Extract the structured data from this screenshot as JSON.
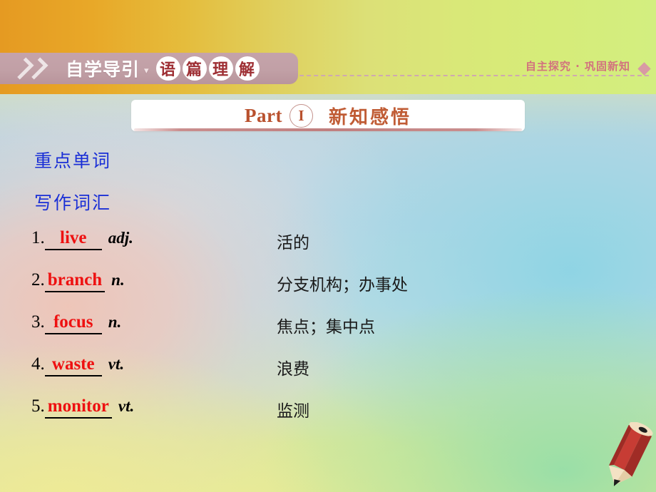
{
  "header": {
    "left_title": "自学导引",
    "separator": "▾",
    "circled_chars": [
      "语",
      "篇",
      "理",
      "解"
    ],
    "right_text": "自主探究 · 巩固新知",
    "chevron_icon": "double-chevron-right-icon",
    "diamond_icon": "diamond-icon"
  },
  "part": {
    "word": "Part",
    "numeral": "I",
    "title_cn": "新知感悟"
  },
  "sections": {
    "heading_1": "重点单词",
    "heading_2": "写作词汇"
  },
  "vocabulary": [
    {
      "index": "1.",
      "answer": "live",
      "pos": "adj.",
      "meaning": "活的"
    },
    {
      "index": "2.",
      "answer": "branch",
      "pos": "n.",
      "meaning": "分支机构；办事处"
    },
    {
      "index": "3.",
      "answer": "focus",
      "pos": "n.",
      "meaning": "焦点；集中点"
    },
    {
      "index": "4.",
      "answer": "waste",
      "pos": "vt.",
      "meaning": "浪费"
    },
    {
      "index": "5.",
      "answer": "monitor",
      "pos": "vt.",
      "meaning": "监测"
    }
  ],
  "decoration": {
    "pencil_icon": "pencil-icon"
  },
  "colors": {
    "banner": "#c1a0a6",
    "answer_red": "#ee1111",
    "heading_blue": "#1a2fd6",
    "part_brown": "#b9512e",
    "header_right_pink": "#d2727e"
  }
}
